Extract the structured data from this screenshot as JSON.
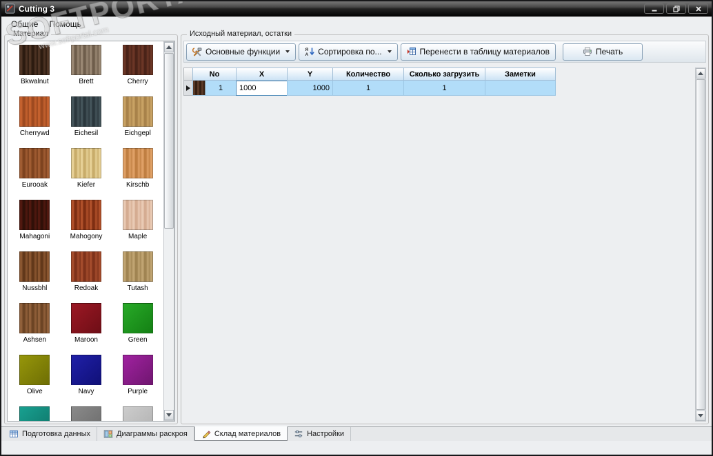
{
  "window": {
    "title": "Cutting 3"
  },
  "watermark": {
    "text": "SOFTPORTAL",
    "tm": "™",
    "url": "www.softportal.com"
  },
  "menu": {
    "items": [
      {
        "name": "menu-general",
        "label": "Общие"
      },
      {
        "name": "menu-help",
        "label": "Помощь"
      }
    ]
  },
  "materials_panel": {
    "title": "Материал",
    "swatches": [
      {
        "label": "Bkwalnut",
        "c1": "#4e3424",
        "c2": "#2c1b10",
        "type": "wood"
      },
      {
        "label": "Brett",
        "c1": "#9a8874",
        "c2": "#6e5d4b",
        "type": "wood"
      },
      {
        "label": "Cherry",
        "c1": "#6b3626",
        "c2": "#4a2318",
        "type": "wood"
      },
      {
        "label": "Cherrywd",
        "c1": "#c4612e",
        "c2": "#9e4a20",
        "type": "wood"
      },
      {
        "label": "Eichesil",
        "c1": "#44545a",
        "c2": "#2a363c",
        "type": "wood"
      },
      {
        "label": "Eichgepl",
        "c1": "#c8a264",
        "c2": "#a8824a",
        "type": "wood"
      },
      {
        "label": "Eurooak",
        "c1": "#a05c32",
        "c2": "#7e431f",
        "type": "wood"
      },
      {
        "label": "Kiefer",
        "c1": "#e6d096",
        "c2": "#c8ac6a",
        "type": "wood"
      },
      {
        "label": "Kirschb",
        "c1": "#dfa066",
        "c2": "#c07f42",
        "type": "wood"
      },
      {
        "label": "Mahagoni",
        "c1": "#50180f",
        "c2": "#301008",
        "type": "wood"
      },
      {
        "label": "Mahogony",
        "c1": "#b0502a",
        "c2": "#7e2e12",
        "type": "wood"
      },
      {
        "label": "Maple",
        "c1": "#e9cab4",
        "c2": "#d5ac92",
        "type": "wood"
      },
      {
        "label": "Nussbhl",
        "c1": "#8a5630",
        "c2": "#62381a",
        "type": "wood"
      },
      {
        "label": "Redoak",
        "c1": "#a44c2c",
        "c2": "#7e321a",
        "type": "wood"
      },
      {
        "label": "Tutash",
        "c1": "#c0a472",
        "c2": "#a08452",
        "type": "wood"
      },
      {
        "label": "Ashsen",
        "c1": "#90603a",
        "c2": "#6c4424",
        "type": "wood"
      },
      {
        "label": "Maroon",
        "c1": "#9c1824",
        "c2": "#6e0e16",
        "type": "solid"
      },
      {
        "label": "Green",
        "c1": "#28aa28",
        "c2": "#148014",
        "type": "solid"
      },
      {
        "label": "Olive",
        "c1": "#96960a",
        "c2": "#6e6e04",
        "type": "solid"
      },
      {
        "label": "Navy",
        "c1": "#2020a8",
        "c2": "#101078",
        "type": "solid"
      },
      {
        "label": "Purple",
        "c1": "#a022a0",
        "c2": "#701670",
        "type": "solid"
      },
      {
        "label": "",
        "c1": "#18a090",
        "c2": "#0e7468",
        "type": "solid"
      },
      {
        "label": "",
        "c1": "#8a8a8a",
        "c2": "#6a6a6a",
        "type": "solid"
      },
      {
        "label": "",
        "c1": "#cccccc",
        "c2": "#b0b0b0",
        "type": "solid"
      }
    ]
  },
  "right_panel": {
    "title": "Исходный материал, остатки",
    "toolbar": {
      "buttons": [
        {
          "name": "main-functions-button",
          "label": "Основные функции",
          "icon": "tools-icon",
          "dropdown": true
        },
        {
          "name": "sort-by-button",
          "label": "Сортировка по...",
          "icon": "sort-icon",
          "dropdown": true
        },
        {
          "name": "transfer-to-materials-button",
          "label": "Перенести в таблицу материалов",
          "icon": "transfer-icon",
          "dropdown": false
        },
        {
          "name": "print-button",
          "label": "Печать",
          "icon": "printer-icon",
          "dropdown": false
        }
      ]
    },
    "table": {
      "columns": [
        "No",
        "X",
        "Y",
        "Количество",
        "Сколько загрузить",
        "Заметки"
      ],
      "rows": [
        {
          "no": "1",
          "x": "1000",
          "y": "1000",
          "quantity": "1",
          "load": "1",
          "notes": "",
          "material_c1": "#5a3a28",
          "material_c2": "#362012"
        }
      ]
    }
  },
  "bottom_tabs": {
    "tabs": [
      {
        "name": "tab-data-preparation",
        "label": "Подготовка данных",
        "icon": "data-prep-icon",
        "active": false
      },
      {
        "name": "tab-cutting-diagrams",
        "label": "Диаграммы раскроя",
        "icon": "diagrams-icon",
        "active": false
      },
      {
        "name": "tab-materials-warehouse",
        "label": "Склад материалов",
        "icon": "warehouse-icon",
        "active": true
      },
      {
        "name": "tab-settings",
        "label": "Настройки",
        "icon": "settings-icon",
        "active": false
      }
    ]
  }
}
